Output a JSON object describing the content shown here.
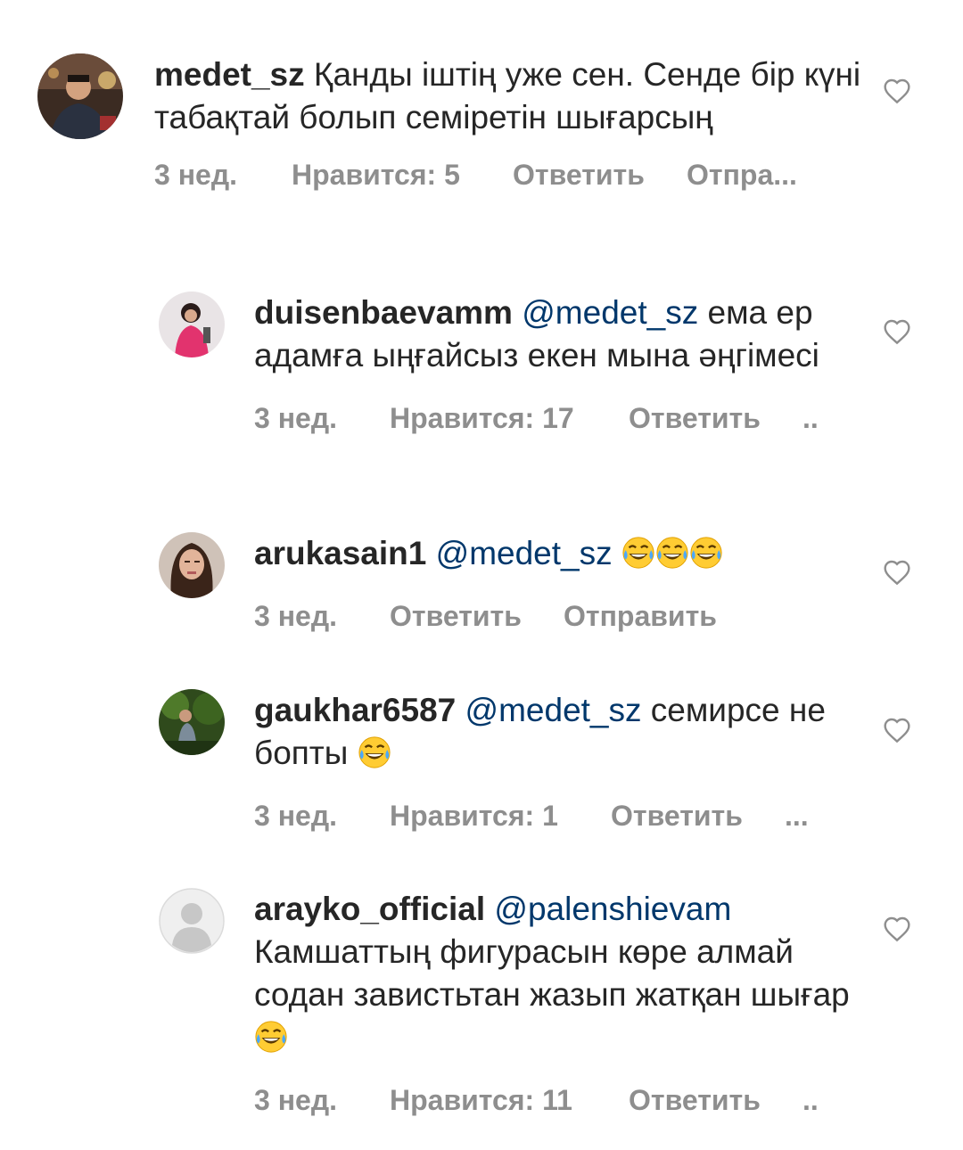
{
  "comments": [
    {
      "username": "medet_sz",
      "mention": "",
      "text": "Қанды іштің уже сен. Сенде бір күні табақтай болып семіретін шығарсың",
      "emoji_count": 0,
      "time": "3 нед.",
      "likes": "Нравится: 5",
      "reply": "Ответить",
      "send": "Отпра...",
      "avatar_icon": "profile-photo-man"
    },
    {
      "username": "duisenbaevamm",
      "mention": "@medet_sz",
      "text": "ема ер адамға ыңғайсыз екен мына әңгімесі",
      "emoji_count": 0,
      "time": "3 нед.",
      "likes": "Нравится: 17",
      "reply": "Ответить",
      "send": "..",
      "avatar_icon": "profile-photo-woman-pink"
    },
    {
      "username": "arukasain1",
      "mention": "@medet_sz",
      "text": "",
      "emoji_count": 3,
      "time": "3 нед.",
      "likes": "",
      "reply": "Ответить",
      "send": "Отправить",
      "avatar_icon": "profile-photo-woman"
    },
    {
      "username": "gaukhar6587",
      "mention": "@medet_sz",
      "text": "семирсе не бопты",
      "emoji_count": 1,
      "time": "3 нед.",
      "likes": "Нравится: 1",
      "reply": "Ответить",
      "send": "...",
      "avatar_icon": "profile-photo-nature"
    },
    {
      "username": "arayko_official",
      "mention": "@palenshievam",
      "text": "Камшаттың фигурасын көре алмай содан завистьтан жазып жатқан шығар",
      "emoji_count": 1,
      "time": "3 нед.",
      "likes": "Нравится: 11",
      "reply": "Ответить",
      "send": "..",
      "avatar_icon": "default-avatar-icon"
    }
  ],
  "emoji_name": "face-with-tears-of-joy-icon",
  "colors": {
    "username": "#262626",
    "mention": "#00376b",
    "meta": "#8e8e8e",
    "heart": "#8e8e8e"
  }
}
